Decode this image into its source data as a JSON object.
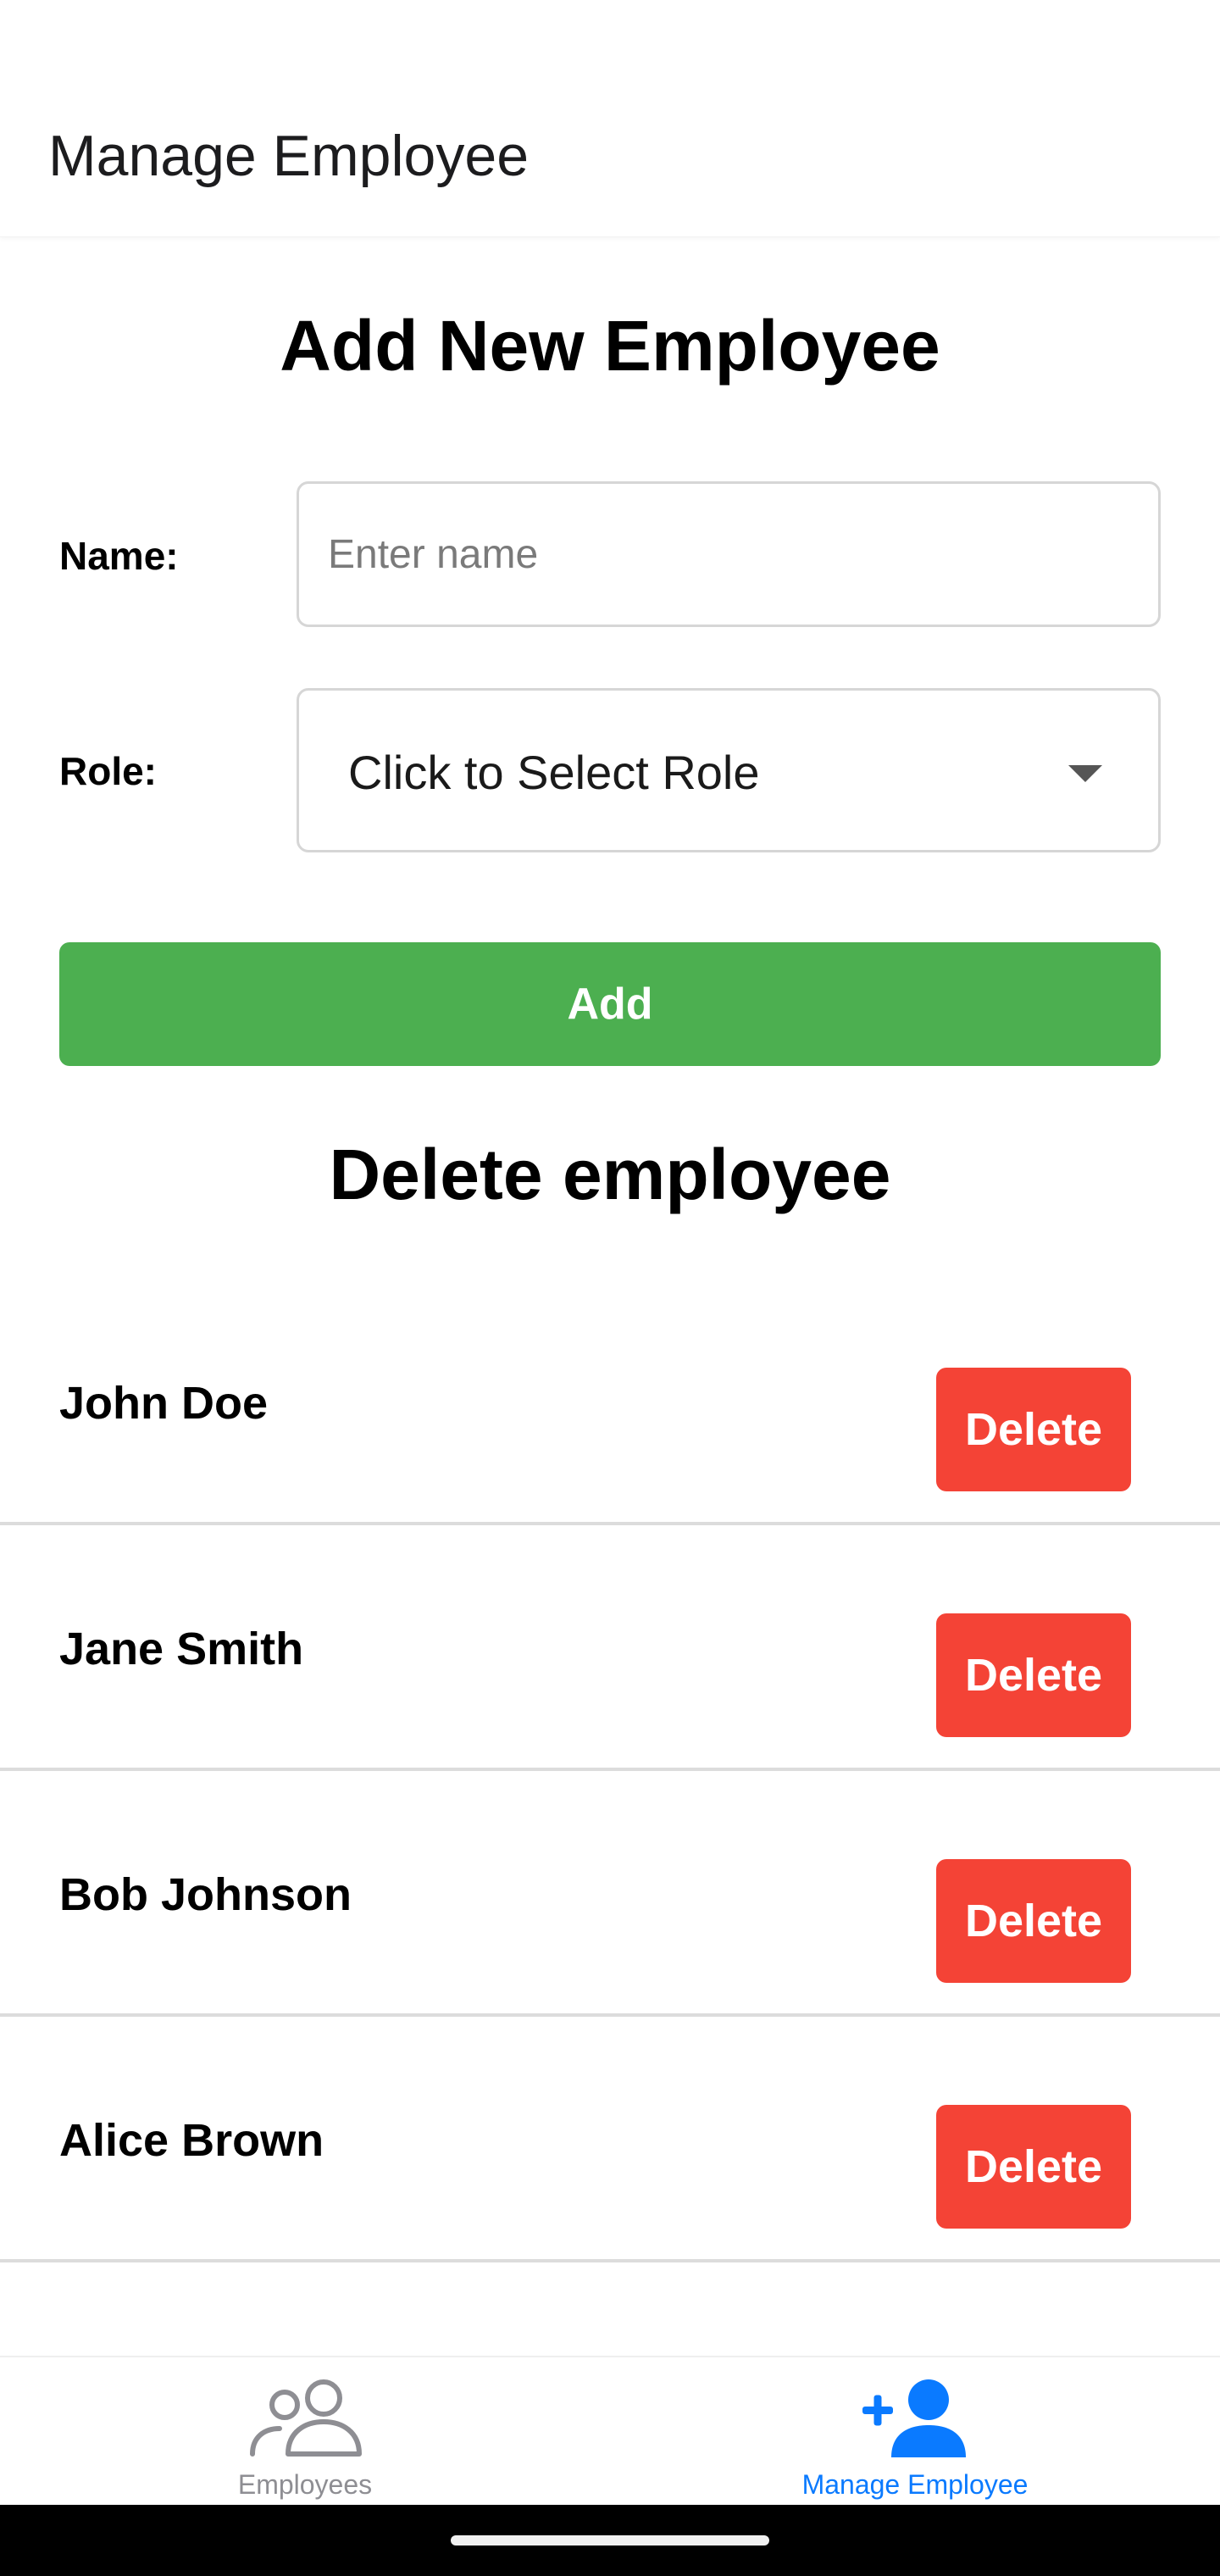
{
  "header": {
    "title": "Manage Employee"
  },
  "add_section": {
    "title": "Add New Employee",
    "name_label": "Name:",
    "name_placeholder": "Enter name",
    "name_value": "",
    "role_label": "Role:",
    "role_select_text": "Click to Select Role",
    "add_label": "Add"
  },
  "delete_section": {
    "title": "Delete employee",
    "delete_label": "Delete",
    "employees": [
      {
        "name": "John Doe"
      },
      {
        "name": "Jane Smith"
      },
      {
        "name": "Bob Johnson"
      },
      {
        "name": "Alice Brown"
      }
    ]
  },
  "tabbar": {
    "tabs": [
      {
        "label": "Employees",
        "icon": "people-outline-icon",
        "active": false
      },
      {
        "label": "Manage Employee",
        "icon": "person-add-icon",
        "active": true
      }
    ]
  },
  "colors": {
    "add_button": "#4caf50",
    "delete_button": "#f44336",
    "active_tab": "#0a7aff",
    "inactive_tab": "#8e8e93"
  }
}
